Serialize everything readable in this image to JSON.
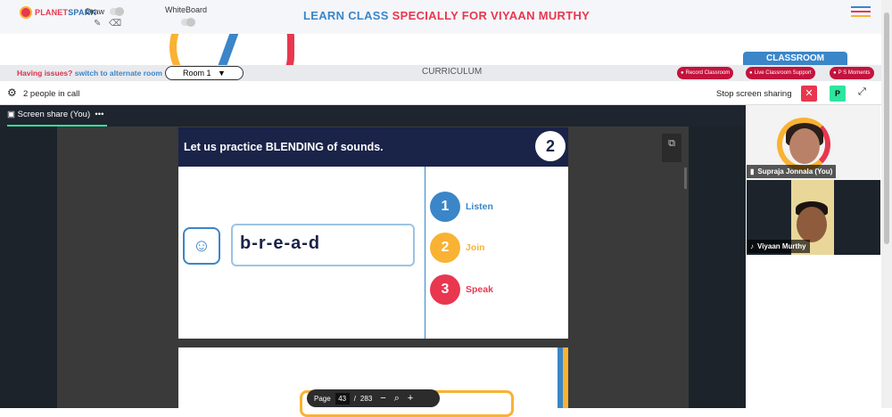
{
  "brand": {
    "name_part1": "PLANET",
    "name_part2": "SPARK"
  },
  "tools": {
    "draw_label": "Draw",
    "whiteboard_label": "WhiteBoard",
    "pencil_icon": "pencil-icon",
    "eraser_icon": "eraser-icon"
  },
  "header": {
    "title_part1": "LEARN CLASS",
    "title_part2": "SPECIALLY FOR VIYAAN MURTHY"
  },
  "menu": {
    "colors": [
      "#3a86c8",
      "#e8374f",
      "#f9b233"
    ]
  },
  "classroom_tab": "CLASSROOM",
  "subbar": {
    "issues_text": "Having issues?",
    "alt_room_link": "switch to alternate room",
    "room_label": "Room 1",
    "room_arrow": "▼",
    "curriculum": "CURRICULUM",
    "pills": [
      "Record Classroom",
      "Live Classroom Support",
      "P S Moments"
    ]
  },
  "callbar": {
    "people_count": "2 people in call",
    "stop_sharing": "Stop screen sharing",
    "stop_icon": "✕",
    "p_label": "P",
    "expand_icon": "⤢"
  },
  "stage": {
    "share_tab": "Screen share (You)",
    "share_menu": "•••"
  },
  "slide": {
    "title": "Let us practice BLENDING of sounds.",
    "number": "2",
    "word": "b-r-e-a-d",
    "steps": [
      {
        "num": "1",
        "label": "Listen",
        "color": "#3a86c8"
      },
      {
        "num": "2",
        "label": "Join",
        "color": "#f9b233"
      },
      {
        "num": "3",
        "label": "Speak",
        "color": "#e8374f"
      }
    ]
  },
  "pager": {
    "page_label": "Page",
    "current": "43",
    "separator": "/",
    "total": "283",
    "zoom_out": "−",
    "zoom_in": "+",
    "zoom_icon": "⌕"
  },
  "participants": [
    {
      "name": "Supraja Jonnala (You)"
    },
    {
      "name": "Viyaan Murthy"
    }
  ]
}
